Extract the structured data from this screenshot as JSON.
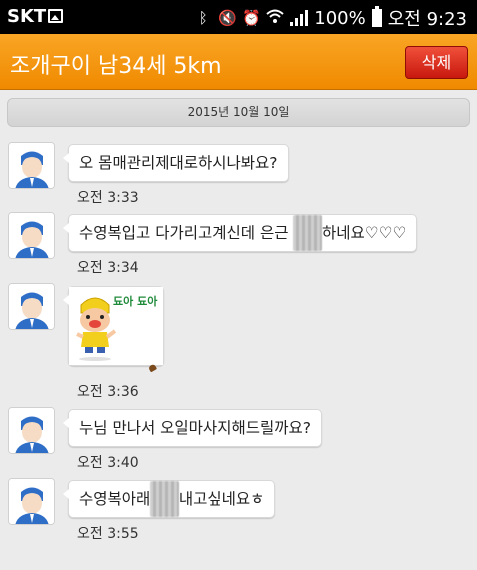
{
  "status_bar": {
    "carrier": "SKT",
    "battery": "100%",
    "time": "오전 9:23"
  },
  "header": {
    "title": "조개구이 남34세 5km",
    "delete_label": "삭제"
  },
  "date_divider": "2015년 10월 10일",
  "messages": [
    {
      "text": "오 몸매관리제대로하시나봐요?",
      "time": "오전 3:33"
    },
    {
      "text_before": "수영복입고 다가리고계신데 은근 ",
      "blurred": "꼴릿",
      "text_after": "하네요♡♡♡",
      "time": "오전 3:34"
    },
    {
      "sticker_text": "됴아 됴아",
      "time": "오전 3:36"
    },
    {
      "text": "누님 만나서 오일마사지해드릴까요?",
      "time": "오전 3:40"
    },
    {
      "text_before": "수영복아래",
      "blurred": "구멍",
      "text_after": "내고싶네요ㅎ",
      "time": "오전 3:55"
    }
  ]
}
